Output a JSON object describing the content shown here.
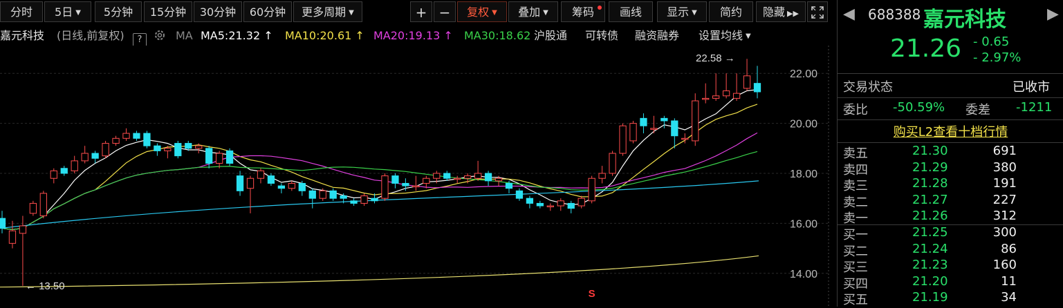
{
  "toolbar": {
    "periods": [
      "分时",
      "5日",
      "5分钟",
      "15分钟",
      "30分钟",
      "60分钟",
      "更多周期"
    ],
    "zoom_in": "+",
    "zoom_out": "−",
    "fuquan": "复权",
    "overlay": "叠加",
    "chips": "筹码",
    "draw": "画线",
    "display": "显示",
    "simple": "简约",
    "hide": "隐藏"
  },
  "infobar": {
    "stock_name": "嘉元科技",
    "mode": "(日线,前复权)",
    "help": "?",
    "ma_label": "MA",
    "ma5": "MA5:21.32 ↑",
    "ma10": "MA10:20.61 ↑",
    "ma20": "MA20:19.13 ↑",
    "ma30": "MA30:18.62",
    "hgt": "沪股通",
    "convertible": "可转债",
    "margin": "融资融券",
    "set_ma": "设置均线"
  },
  "chart_data": {
    "type": "candlestick",
    "y_ticks": [
      "22.00",
      "20.00",
      "18.00",
      "16.00",
      "14.00"
    ],
    "ylim": [
      13.0,
      23.0
    ],
    "high_label": "22.58",
    "low_label": "13.50",
    "marker": "S",
    "candles": [
      {
        "o": 16.2,
        "c": 15.8,
        "h": 16.5,
        "l": 15.6
      },
      {
        "o": 15.2,
        "c": 15.7,
        "h": 16.1,
        "l": 15.0
      },
      {
        "o": 15.6,
        "c": 15.9,
        "h": 16.3,
        "l": 13.5
      },
      {
        "o": 16.4,
        "c": 16.8,
        "h": 16.9,
        "l": 16.3
      },
      {
        "o": 16.3,
        "c": 17.2,
        "h": 17.3,
        "l": 16.2
      },
      {
        "o": 17.8,
        "c": 18.1,
        "h": 18.2,
        "l": 17.6
      },
      {
        "o": 18.2,
        "c": 18.0,
        "h": 18.3,
        "l": 17.9
      },
      {
        "o": 18.1,
        "c": 18.5,
        "h": 18.7,
        "l": 18.0
      },
      {
        "o": 18.5,
        "c": 18.8,
        "h": 19.1,
        "l": 18.4
      },
      {
        "o": 18.8,
        "c": 18.6,
        "h": 18.9,
        "l": 18.4
      },
      {
        "o": 18.7,
        "c": 19.2,
        "h": 19.3,
        "l": 18.6
      },
      {
        "o": 19.2,
        "c": 19.4,
        "h": 19.5,
        "l": 19.1
      },
      {
        "o": 19.4,
        "c": 19.6,
        "h": 19.8,
        "l": 19.3
      },
      {
        "o": 19.6,
        "c": 19.4,
        "h": 19.7,
        "l": 19.3
      },
      {
        "o": 19.6,
        "c": 19.1,
        "h": 19.7,
        "l": 19.0
      },
      {
        "o": 19.1,
        "c": 18.9,
        "h": 19.2,
        "l": 18.7
      },
      {
        "o": 18.9,
        "c": 19.0,
        "h": 19.1,
        "l": 18.6
      },
      {
        "o": 19.2,
        "c": 18.7,
        "h": 19.3,
        "l": 18.6
      },
      {
        "o": 19.2,
        "c": 19.0,
        "h": 19.3,
        "l": 18.9
      },
      {
        "o": 19.0,
        "c": 19.1,
        "h": 19.2,
        "l": 18.8
      },
      {
        "o": 19.0,
        "c": 18.4,
        "h": 19.1,
        "l": 18.2
      },
      {
        "o": 18.4,
        "c": 18.8,
        "h": 18.9,
        "l": 18.2
      },
      {
        "o": 18.9,
        "c": 18.4,
        "h": 19.0,
        "l": 18.3
      },
      {
        "o": 17.9,
        "c": 17.3,
        "h": 18.1,
        "l": 17.1
      },
      {
        "o": 17.4,
        "c": 17.8,
        "h": 17.9,
        "l": 16.4
      },
      {
        "o": 17.8,
        "c": 18.1,
        "h": 18.2,
        "l": 17.6
      },
      {
        "o": 17.9,
        "c": 17.6,
        "h": 18.0,
        "l": 17.5
      },
      {
        "o": 17.5,
        "c": 17.4,
        "h": 17.6,
        "l": 17.2
      },
      {
        "o": 17.4,
        "c": 17.6,
        "h": 17.7,
        "l": 17.3
      },
      {
        "o": 17.6,
        "c": 17.3,
        "h": 17.7,
        "l": 17.1
      },
      {
        "o": 17.3,
        "c": 17.0,
        "h": 17.4,
        "l": 16.6
      },
      {
        "o": 17.0,
        "c": 17.3,
        "h": 17.4,
        "l": 16.9
      },
      {
        "o": 17.3,
        "c": 17.0,
        "h": 17.4,
        "l": 16.9
      },
      {
        "o": 17.1,
        "c": 17.0,
        "h": 17.2,
        "l": 16.8
      },
      {
        "o": 16.9,
        "c": 16.8,
        "h": 17.0,
        "l": 16.7
      },
      {
        "o": 16.8,
        "c": 17.1,
        "h": 17.2,
        "l": 16.7
      },
      {
        "o": 17.0,
        "c": 16.9,
        "h": 17.2,
        "l": 16.8
      },
      {
        "o": 17.0,
        "c": 17.9,
        "h": 18.0,
        "l": 16.9
      },
      {
        "o": 17.9,
        "c": 17.6,
        "h": 18.0,
        "l": 17.4
      },
      {
        "o": 17.6,
        "c": 17.5,
        "h": 17.8,
        "l": 17.3
      },
      {
        "o": 17.5,
        "c": 17.5,
        "h": 17.9,
        "l": 17.3
      },
      {
        "o": 17.6,
        "c": 17.8,
        "h": 17.9,
        "l": 17.4
      },
      {
        "o": 17.8,
        "c": 18.0,
        "h": 18.1,
        "l": 17.6
      },
      {
        "o": 18.0,
        "c": 17.8,
        "h": 18.1,
        "l": 17.7
      },
      {
        "o": 17.8,
        "c": 17.8,
        "h": 17.9,
        "l": 17.6
      },
      {
        "o": 17.8,
        "c": 17.9,
        "h": 18.0,
        "l": 17.6
      },
      {
        "o": 17.8,
        "c": 18.0,
        "h": 18.5,
        "l": 17.7
      },
      {
        "o": 18.0,
        "c": 17.7,
        "h": 18.1,
        "l": 17.5
      },
      {
        "o": 17.7,
        "c": 17.8,
        "h": 17.9,
        "l": 17.5
      },
      {
        "o": 17.6,
        "c": 17.4,
        "h": 17.7,
        "l": 17.2
      },
      {
        "o": 17.3,
        "c": 17.0,
        "h": 17.4,
        "l": 16.9
      },
      {
        "o": 17.0,
        "c": 16.8,
        "h": 17.1,
        "l": 16.6
      },
      {
        "o": 16.8,
        "c": 16.7,
        "h": 16.9,
        "l": 16.6
      },
      {
        "o": 16.7,
        "c": 16.7,
        "h": 16.8,
        "l": 16.5
      },
      {
        "o": 16.7,
        "c": 16.9,
        "h": 17.0,
        "l": 16.5
      },
      {
        "o": 16.8,
        "c": 16.6,
        "h": 16.9,
        "l": 16.4
      },
      {
        "o": 16.7,
        "c": 17.0,
        "h": 17.1,
        "l": 16.6
      },
      {
        "o": 16.9,
        "c": 17.8,
        "h": 17.9,
        "l": 16.8
      },
      {
        "o": 17.8,
        "c": 18.0,
        "h": 18.3,
        "l": 17.6
      },
      {
        "o": 18.0,
        "c": 18.8,
        "h": 18.9,
        "l": 17.9
      },
      {
        "o": 18.8,
        "c": 19.9,
        "h": 20.0,
        "l": 18.7
      },
      {
        "o": 19.3,
        "c": 20.0,
        "h": 20.1,
        "l": 19.2
      },
      {
        "o": 20.2,
        "c": 19.9,
        "h": 20.4,
        "l": 19.6
      },
      {
        "o": 19.8,
        "c": 19.8,
        "h": 20.3,
        "l": 19.6
      },
      {
        "o": 20.2,
        "c": 20.1,
        "h": 20.3,
        "l": 19.8
      },
      {
        "o": 20.1,
        "c": 19.5,
        "h": 20.2,
        "l": 19.0
      },
      {
        "o": 19.4,
        "c": 19.4,
        "h": 19.6,
        "l": 19.2
      },
      {
        "o": 19.3,
        "c": 20.9,
        "h": 21.2,
        "l": 19.1
      },
      {
        "o": 21.0,
        "c": 21.0,
        "h": 21.6,
        "l": 20.8
      },
      {
        "o": 21.0,
        "c": 21.1,
        "h": 22.0,
        "l": 20.9
      },
      {
        "o": 21.1,
        "c": 21.3,
        "h": 22.0,
        "l": 21.0
      },
      {
        "o": 21.0,
        "c": 21.2,
        "h": 22.0,
        "l": 20.9
      },
      {
        "o": 21.4,
        "c": 21.9,
        "h": 22.58,
        "l": 21.3
      },
      {
        "o": 21.6,
        "c": 21.26,
        "h": 22.3,
        "l": 21.0
      }
    ]
  },
  "quote": {
    "code": "688388",
    "name": "嘉元科技",
    "price": "21.26",
    "change": "- 0.65",
    "change_pct": "- 2.97%",
    "status_label": "交易状态",
    "status_value": "已收市",
    "webi_label": "委比",
    "webi_value": "-50.59%",
    "weicha_label": "委差",
    "weicha_value": "-1211",
    "l2_link": "购买L2查看十档行情"
  },
  "order_book": [
    {
      "label": "卖五",
      "price": "21.30",
      "vol": "691"
    },
    {
      "label": "卖四",
      "price": "21.29",
      "vol": "380"
    },
    {
      "label": "卖三",
      "price": "21.28",
      "vol": "191"
    },
    {
      "label": "卖二",
      "price": "21.27",
      "vol": "227"
    },
    {
      "label": "卖一",
      "price": "21.26",
      "vol": "312"
    },
    {
      "label": "买一",
      "price": "21.25",
      "vol": "300"
    },
    {
      "label": "买二",
      "price": "21.24",
      "vol": "86"
    },
    {
      "label": "买三",
      "price": "21.23",
      "vol": "160"
    },
    {
      "label": "买四",
      "price": "21.20",
      "vol": "11"
    },
    {
      "label": "买五",
      "price": "21.19",
      "vol": "34"
    }
  ],
  "colors": {
    "up": "#ff4d4d",
    "down": "#29e0f0",
    "ma5": "#ffffff",
    "ma10": "#f2e14a",
    "ma20": "#e040e0",
    "ma30": "#3ad24a",
    "green": "#29e06a"
  }
}
